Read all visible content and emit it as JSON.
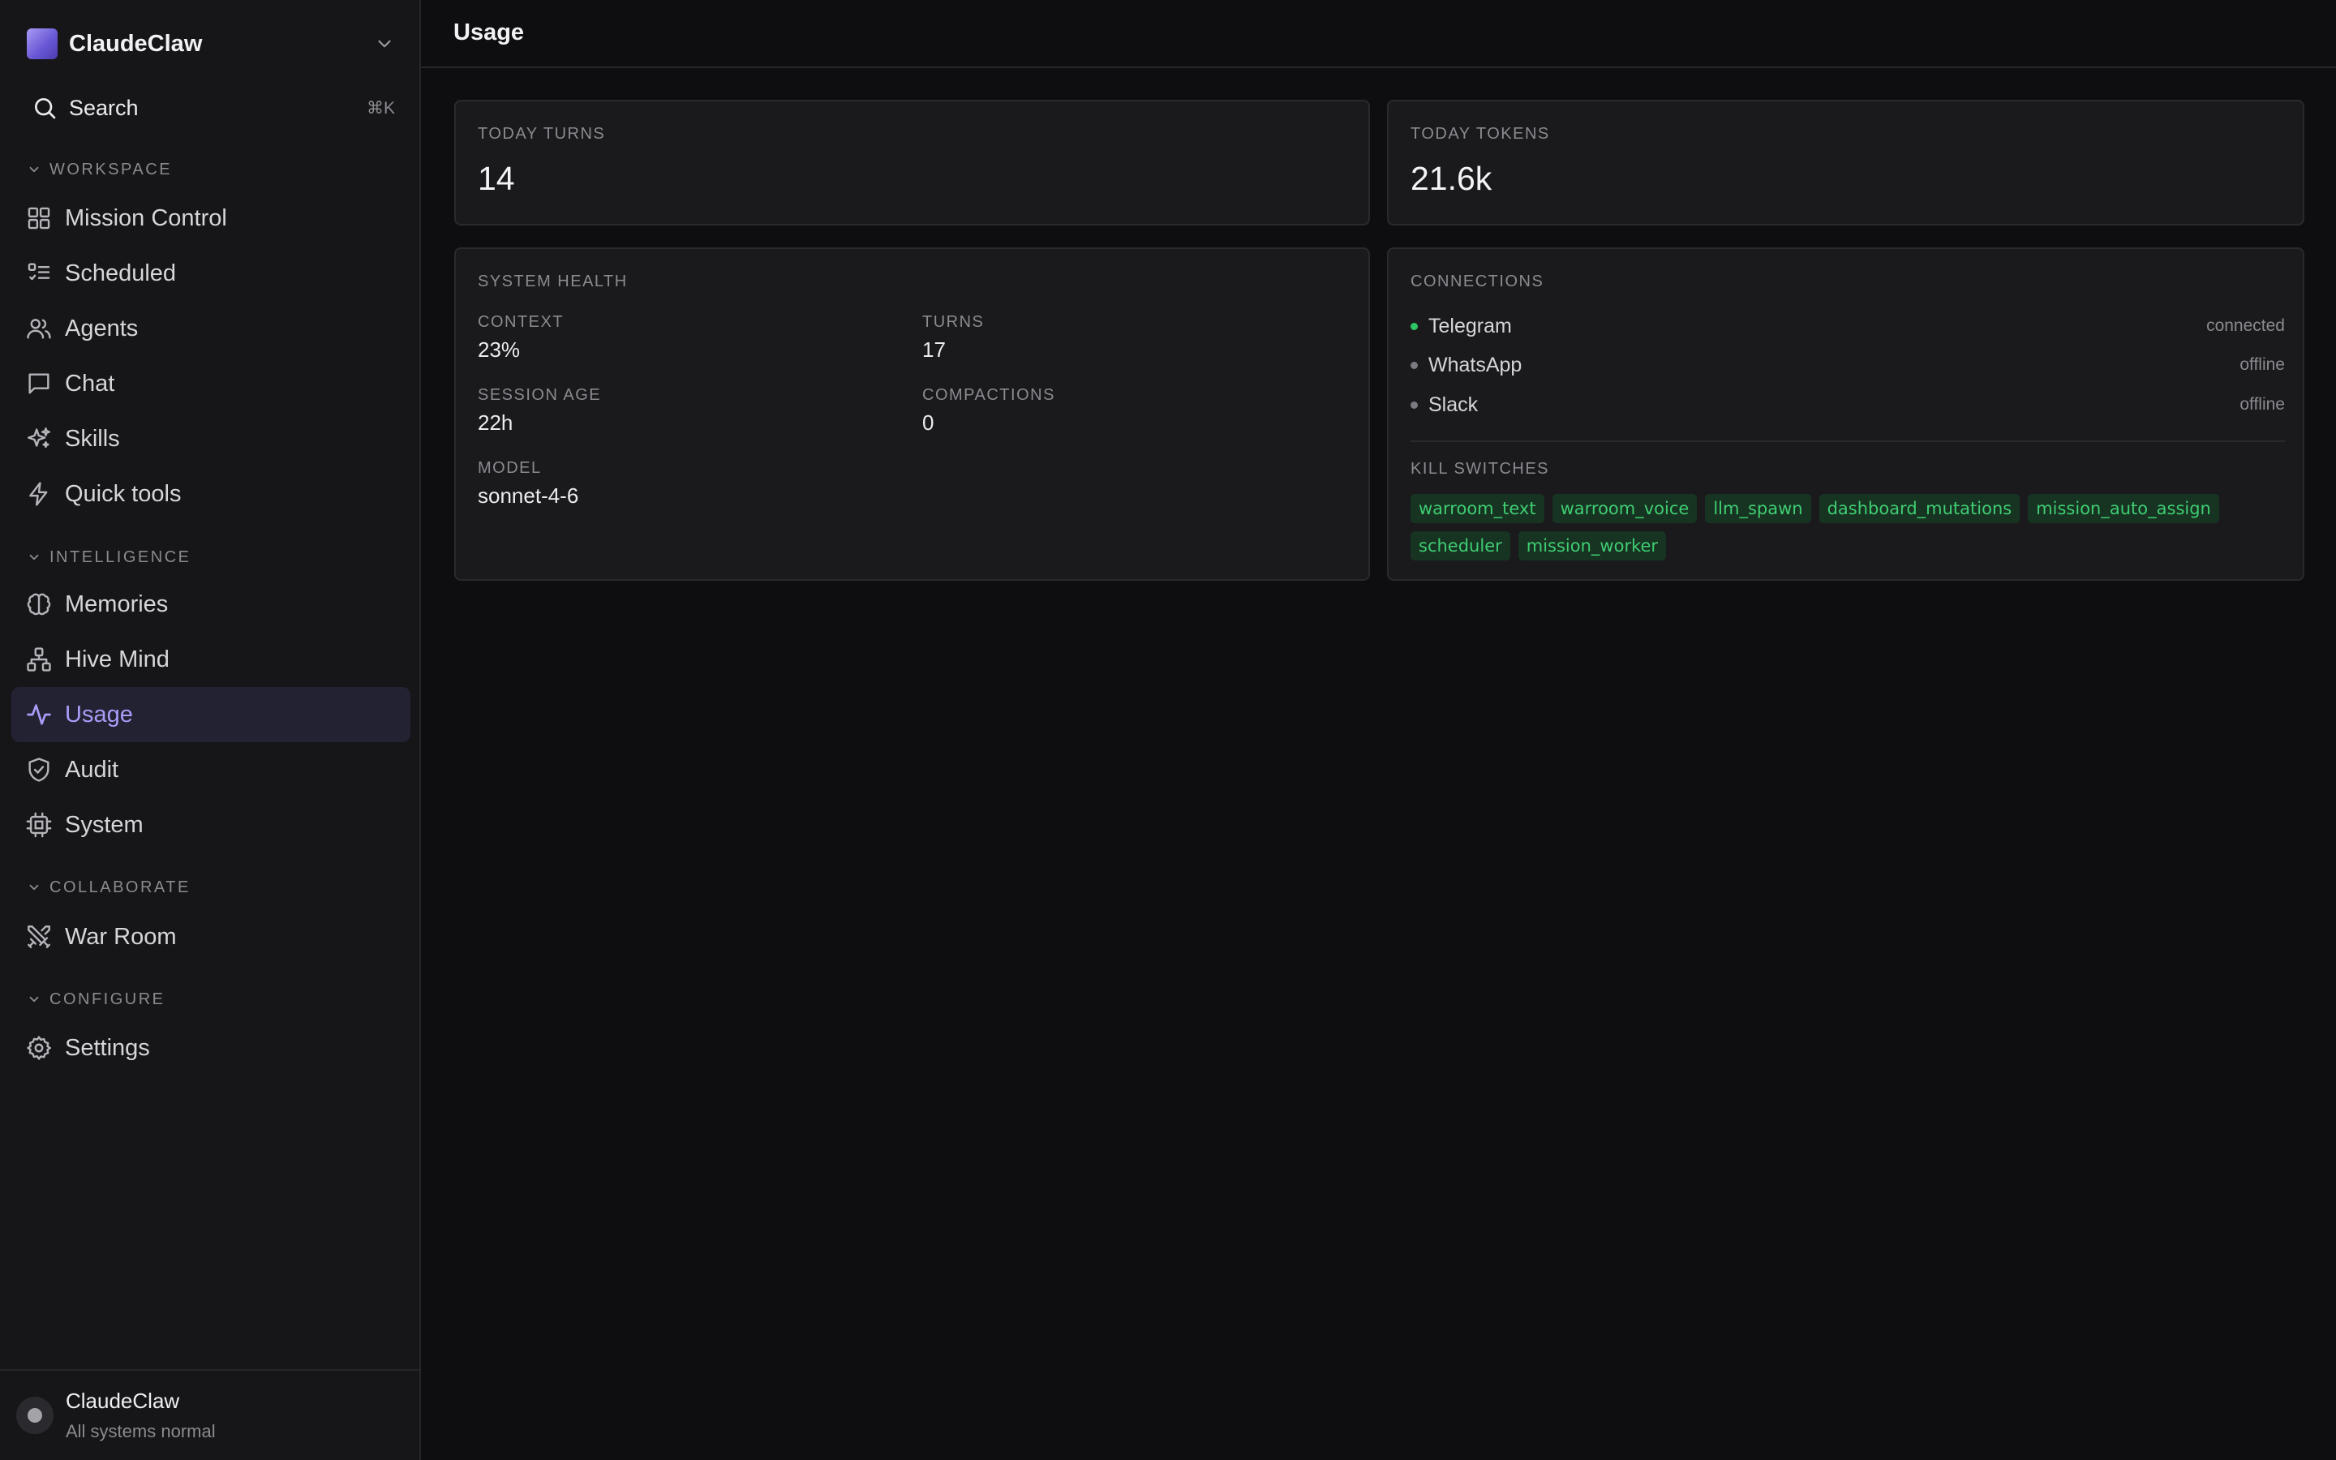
{
  "sidebar": {
    "brand": "ClaudeClaw",
    "search": {
      "label": "Search",
      "shortcut": "⌘K"
    },
    "sections": {
      "workspace": "WORKSPACE",
      "intelligence": "INTELLIGENCE",
      "collaborate": "COLLABORATE",
      "configure": "CONFIGURE"
    },
    "items": {
      "mission_control": "Mission Control",
      "scheduled": "Scheduled",
      "agents": "Agents",
      "chat": "Chat",
      "skills": "Skills",
      "quick_tools": "Quick tools",
      "memories": "Memories",
      "hive_mind": "Hive Mind",
      "usage": "Usage",
      "audit": "Audit",
      "system": "System",
      "war_room": "War Room",
      "settings": "Settings"
    },
    "active_item": "usage",
    "footer": {
      "name": "ClaudeClaw",
      "status": "All systems normal"
    }
  },
  "header": {
    "title": "Usage"
  },
  "stats": {
    "today_turns": {
      "label": "TODAY TURNS",
      "value": "14"
    },
    "today_tokens": {
      "label": "TODAY TOKENS",
      "value": "21.6k"
    }
  },
  "system_health": {
    "label": "SYSTEM HEALTH",
    "context": {
      "label": "CONTEXT",
      "value": "23%"
    },
    "turns": {
      "label": "TURNS",
      "value": "17"
    },
    "session_age": {
      "label": "SESSION AGE",
      "value": "22h"
    },
    "compactions": {
      "label": "COMPACTIONS",
      "value": "0"
    },
    "model": {
      "label": "MODEL",
      "value": "sonnet-4-6"
    }
  },
  "connections": {
    "label": "CONNECTIONS",
    "items": [
      {
        "name": "Telegram",
        "status": "connected"
      },
      {
        "name": "WhatsApp",
        "status": "offline"
      },
      {
        "name": "Slack",
        "status": "offline"
      }
    ],
    "kill_switches_label": "KILL SWITCHES",
    "kill_switches": [
      "warroom_text",
      "warroom_voice",
      "llm_spawn",
      "dashboard_mutations",
      "mission_auto_assign",
      "scheduler",
      "mission_worker"
    ]
  },
  "colors": {
    "accent": "#a99cf8",
    "connected": "#2fc464",
    "offline": "#7a7a80",
    "chip_text": "#3fcd72",
    "chip_bg": "#173322"
  }
}
